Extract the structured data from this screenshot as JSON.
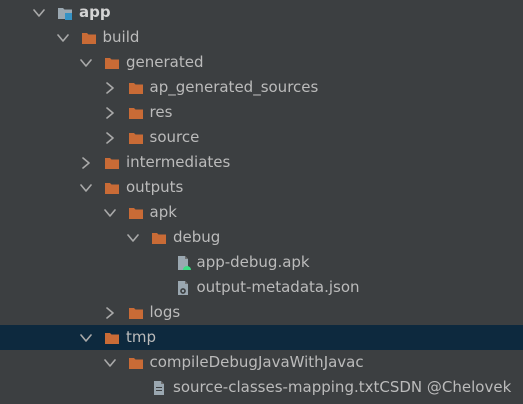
{
  "tree": {
    "items": [
      {
        "label": "app",
        "depth": 0,
        "expanded": true,
        "icon": "module-folder-icon",
        "bold": true
      },
      {
        "label": "build",
        "depth": 1,
        "expanded": true,
        "icon": "folder-icon"
      },
      {
        "label": "generated",
        "depth": 2,
        "expanded": true,
        "icon": "folder-icon"
      },
      {
        "label": "ap_generated_sources",
        "depth": 3,
        "expanded": false,
        "icon": "folder-icon"
      },
      {
        "label": "res",
        "depth": 3,
        "expanded": false,
        "icon": "folder-icon"
      },
      {
        "label": "source",
        "depth": 3,
        "expanded": false,
        "icon": "folder-icon"
      },
      {
        "label": "intermediates",
        "depth": 2,
        "expanded": false,
        "icon": "folder-icon"
      },
      {
        "label": "outputs",
        "depth": 2,
        "expanded": true,
        "icon": "folder-icon"
      },
      {
        "label": "apk",
        "depth": 3,
        "expanded": true,
        "icon": "folder-icon"
      },
      {
        "label": "debug",
        "depth": 4,
        "expanded": true,
        "icon": "folder-icon"
      },
      {
        "label": "app-debug.apk",
        "depth": 5,
        "leaf": true,
        "icon": "apk-file-icon"
      },
      {
        "label": "output-metadata.json",
        "depth": 5,
        "leaf": true,
        "icon": "json-file-icon"
      },
      {
        "label": "logs",
        "depth": 3,
        "expanded": false,
        "icon": "folder-icon"
      },
      {
        "label": "tmp",
        "depth": 2,
        "expanded": true,
        "icon": "folder-icon",
        "selected": true
      },
      {
        "label": "compileDebugJavaWithJavac",
        "depth": 3,
        "expanded": true,
        "icon": "folder-icon"
      },
      {
        "label": "source-classes-mapping.txt",
        "depth": 4,
        "leaf": true,
        "icon": "text-file-icon"
      }
    ]
  },
  "watermark": "CSDN @Chelovek",
  "colors": {
    "background": "#3c3f41",
    "selected_row": "#0d293e",
    "folder": "#c96b36",
    "text": "#bbbbbb",
    "android_green": "#3ddc84"
  }
}
